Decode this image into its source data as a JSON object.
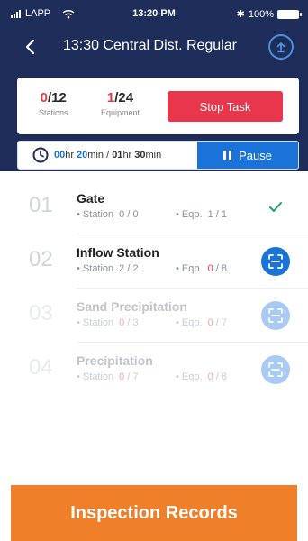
{
  "status_bar": {
    "carrier": "LAPP",
    "time": "13:20 PM",
    "battery": "100%"
  },
  "nav": {
    "title": "13:30 Central Dist. Regular"
  },
  "summary": {
    "stations_done": "0",
    "stations_total": "/12",
    "stations_label": "Stations",
    "equipment_done": "1",
    "equipment_total": "/24",
    "equipment_label": "Equipment",
    "stop_label": "Stop Task"
  },
  "timer": {
    "elapsed_hr": "00",
    "elapsed_hr_unit": "hr",
    "elapsed_min": "20",
    "elapsed_min_unit": "min",
    "separator": " / ",
    "total_hr": "01",
    "total_hr_unit": "hr",
    "total_min": "30",
    "total_min_unit": "min",
    "pause_label": "Pause"
  },
  "tasks": [
    {
      "index": "01",
      "name": "Gate",
      "station_label": "Station",
      "station_value": "0 / 0",
      "eqp_label": "Eqp.",
      "eqp_done": "1",
      "eqp_total": " / 1",
      "action": "check-icon"
    },
    {
      "index": "02",
      "name": "Inflow Station",
      "station_label": "Station",
      "station_value": "2 / 2",
      "eqp_label": "Eqp.",
      "eqp_done": "0",
      "eqp_total": " / 8",
      "action": "scan-icon"
    },
    {
      "index": "03",
      "name": "Sand Precipitation",
      "station_label": "Station",
      "station_done": "0",
      "station_total": " / 3",
      "eqp_label": "Eqp.",
      "eqp_done": "0",
      "eqp_total": " / 7",
      "action": "scan-icon"
    },
    {
      "index": "04",
      "name": "Precipitation",
      "station_label": "Station",
      "station_done": "0",
      "station_total": " / 7",
      "eqp_label": "Eqp.",
      "eqp_done": "0",
      "eqp_total": " / 8",
      "action": "scan-icon"
    }
  ],
  "footer": {
    "label": "Inspection Records"
  },
  "colors": {
    "header": "#1e2d5a",
    "accent": "#1a73d9",
    "danger": "#e8364c",
    "footer": "#f07f2a",
    "success": "#1aa36b"
  }
}
